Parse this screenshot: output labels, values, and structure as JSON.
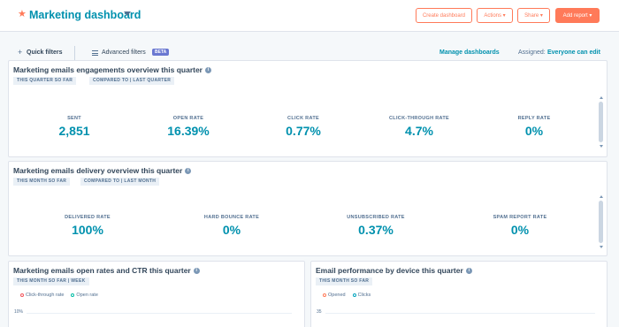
{
  "header": {
    "title": "Marketing dashboard",
    "buttons": {
      "create": "Create dashboard",
      "actions": "Actions ▾",
      "share": "Share ▾",
      "add_report": "Add report ▾"
    }
  },
  "filters": {
    "quick": "Quick filters",
    "advanced": "Advanced filters",
    "beta": "BETA",
    "manage": "Manage dashboards",
    "assigned_label": "Assigned:",
    "assigned_value": "Everyone can edit"
  },
  "engagement_card": {
    "title": "Marketing emails engagements overview this quarter",
    "tags": [
      "THIS QUARTER SO FAR",
      "COMPARED TO | LAST QUARTER"
    ],
    "metrics": [
      {
        "label": "SENT",
        "value": "2,851"
      },
      {
        "label": "OPEN RATE",
        "value": "16.39%"
      },
      {
        "label": "CLICK RATE",
        "value": "0.77%"
      },
      {
        "label": "CLICK-THROUGH RATE",
        "value": "4.7%"
      },
      {
        "label": "REPLY RATE",
        "value": "0%"
      }
    ]
  },
  "delivery_card": {
    "title": "Marketing emails delivery overview this quarter",
    "tags": [
      "THIS MONTH SO FAR",
      "COMPARED TO | LAST MONTH"
    ],
    "metrics": [
      {
        "label": "DELIVERED RATE",
        "value": "100%"
      },
      {
        "label": "HARD BOUNCE RATE",
        "value": "0%"
      },
      {
        "label": "UNSUBSCRIBED RATE",
        "value": "0.37%"
      },
      {
        "label": "SPAM REPORT RATE",
        "value": "0%"
      }
    ]
  },
  "open_rates_card": {
    "title": "Marketing emails open rates and CTR this quarter",
    "tag": "THIS MONTH SO FAR | WEEK",
    "legend": [
      {
        "label": "Click-through rate",
        "color": "#f2545b"
      },
      {
        "label": "Open rate",
        "color": "#00bda5"
      }
    ],
    "ytick": "10%"
  },
  "device_card": {
    "title": "Email performance by device this quarter",
    "tag": "THIS MONTH SO FAR",
    "legend": [
      {
        "label": "Opened",
        "color": "#ff7a59"
      },
      {
        "label": "Clicks",
        "color": "#00a4bd"
      }
    ],
    "ytick": "35"
  },
  "colors": {
    "accent": "#ff7a59",
    "link": "#0091ae",
    "text": "#33475b"
  }
}
